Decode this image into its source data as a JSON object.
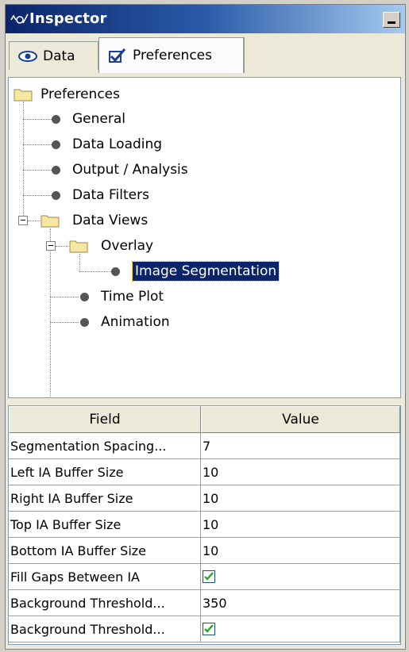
{
  "window": {
    "title": "Inspector"
  },
  "tabs": [
    {
      "label": "Data",
      "icon": "eye-icon"
    },
    {
      "label": "Preferences",
      "icon": "checkbox-icon"
    }
  ],
  "tree": {
    "root": "Preferences",
    "items": {
      "general": "General",
      "data_loading": "Data Loading",
      "output_analysis": "Output / Analysis",
      "data_filters": "Data Filters",
      "data_views": "Data Views",
      "overlay": "Overlay",
      "image_segmentation": "Image Segmentation",
      "time_plot": "Time Plot",
      "animation": "Animation"
    },
    "selected": "Image Segmentation"
  },
  "table": {
    "headers": {
      "field": "Field",
      "value": "Value"
    },
    "rows": [
      {
        "field": "Segmentation Spacing...",
        "value": "7",
        "type": "text"
      },
      {
        "field": "Left IA Buffer Size",
        "value": "10",
        "type": "text"
      },
      {
        "field": "Right IA Buffer Size",
        "value": "10",
        "type": "text"
      },
      {
        "field": "Top IA Buffer Size",
        "value": "10",
        "type": "text"
      },
      {
        "field": "Bottom IA Buffer Size",
        "value": "10",
        "type": "text"
      },
      {
        "field": "Fill Gaps Between IA",
        "checked": true,
        "type": "checkbox"
      },
      {
        "field": "Background Threshold...",
        "value": "350",
        "type": "text"
      },
      {
        "field": "Background Threshold...",
        "checked": true,
        "type": "checkbox"
      }
    ]
  },
  "colors": {
    "titlebar_start": "#0a246a",
    "titlebar_end": "#a6caf0",
    "selection": "#0a246a"
  }
}
